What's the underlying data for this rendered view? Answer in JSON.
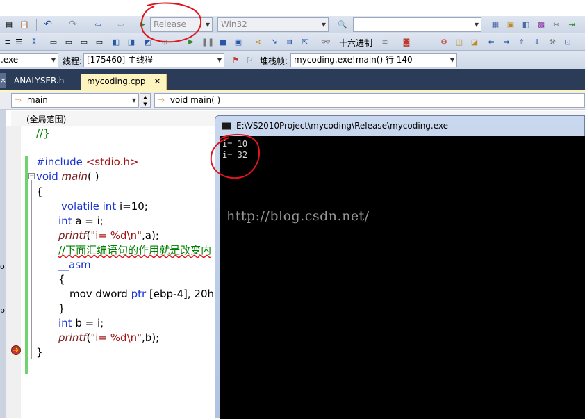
{
  "toolbar1": {
    "config": "Release",
    "platform": "Win32",
    "search": ""
  },
  "toolbar2": {
    "hex_label": "十六进制"
  },
  "toolbar3": {
    "exe_name": ".exe",
    "thread_label": "线程:",
    "thread_value": "[175460] 主线程",
    "stack_label": "堆栈帧:",
    "stack_value": "mycoding.exe!main()  行 140"
  },
  "tabs": [
    {
      "label": "ANALYSER.h",
      "active": false
    },
    {
      "label": "mycoding.cpp",
      "active": true
    }
  ],
  "nav": {
    "scope": "main",
    "function": "void main( )",
    "global_scope": "(全局范围)"
  },
  "code_lines": [
    "//}",
    "",
    "#include <stdio.h>",
    "void main( )",
    "{",
    "volatile int i=10;",
    "int a = i;",
    "printf(\"i= %d\\n\",a);",
    "//下面汇编语句的作用就是改变内",
    "__asm",
    "{",
    "mov dword ptr [ebp-4], 20h",
    "}",
    "int b = i;",
    "printf(\"i= %d\\n\",b);",
    "}"
  ],
  "console": {
    "title": "E:\\VS2010Project\\mycoding\\Release\\mycoding.exe",
    "output": [
      "i= 10",
      "i= 32"
    ],
    "watermark": "http://blog.csdn.net/"
  },
  "left_edge_fragments": [
    "o",
    "p"
  ],
  "colors": {
    "annotation_red": "#e0151d",
    "keyword_blue": "#1a34d6",
    "comment_green": "#008000",
    "string_red": "#a31515",
    "vs_blue_frame": "#2b3c59",
    "active_tab": "#fdf4bf"
  }
}
